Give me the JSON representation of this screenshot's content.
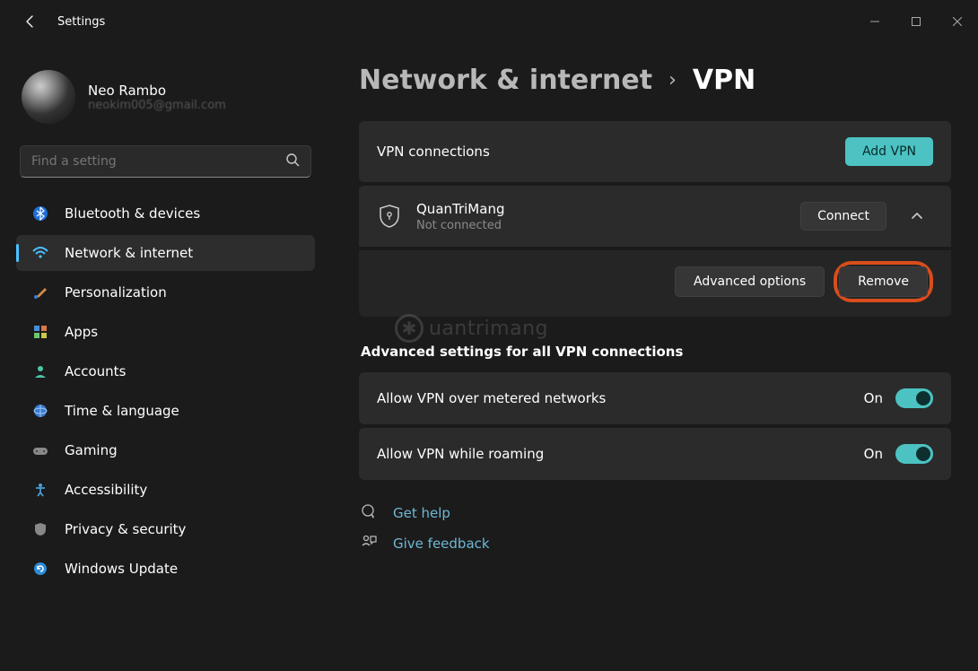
{
  "app_title": "Settings",
  "profile": {
    "name": "Neo Rambo",
    "email": "neokim005@gmail.com"
  },
  "search": {
    "placeholder": "Find a setting"
  },
  "sidebar": {
    "items": [
      {
        "icon": "bluetooth",
        "label": "Bluetooth & devices"
      },
      {
        "icon": "wifi",
        "label": "Network & internet"
      },
      {
        "icon": "brush",
        "label": "Personalization"
      },
      {
        "icon": "apps",
        "label": "Apps"
      },
      {
        "icon": "person",
        "label": "Accounts"
      },
      {
        "icon": "globe",
        "label": "Time & language"
      },
      {
        "icon": "gamepad",
        "label": "Gaming"
      },
      {
        "icon": "access",
        "label": "Accessibility"
      },
      {
        "icon": "shield",
        "label": "Privacy & security"
      },
      {
        "icon": "update",
        "label": "Windows Update"
      }
    ],
    "active_index": 1
  },
  "breadcrumb": {
    "parent": "Network & internet",
    "current": "VPN"
  },
  "vpn": {
    "section_title": "VPN connections",
    "add_button": "Add VPN",
    "connection": {
      "name": "QuanTriMang",
      "status": "Not connected",
      "connect_button": "Connect",
      "advanced_button": "Advanced options",
      "remove_button": "Remove"
    }
  },
  "advanced": {
    "heading": "Advanced settings for all VPN connections",
    "rows": [
      {
        "label": "Allow VPN over metered networks",
        "state": "On",
        "on": true
      },
      {
        "label": "Allow VPN while roaming",
        "state": "On",
        "on": true
      }
    ]
  },
  "links": {
    "help": "Get help",
    "feedback": "Give feedback"
  },
  "watermark": "uantrimang"
}
